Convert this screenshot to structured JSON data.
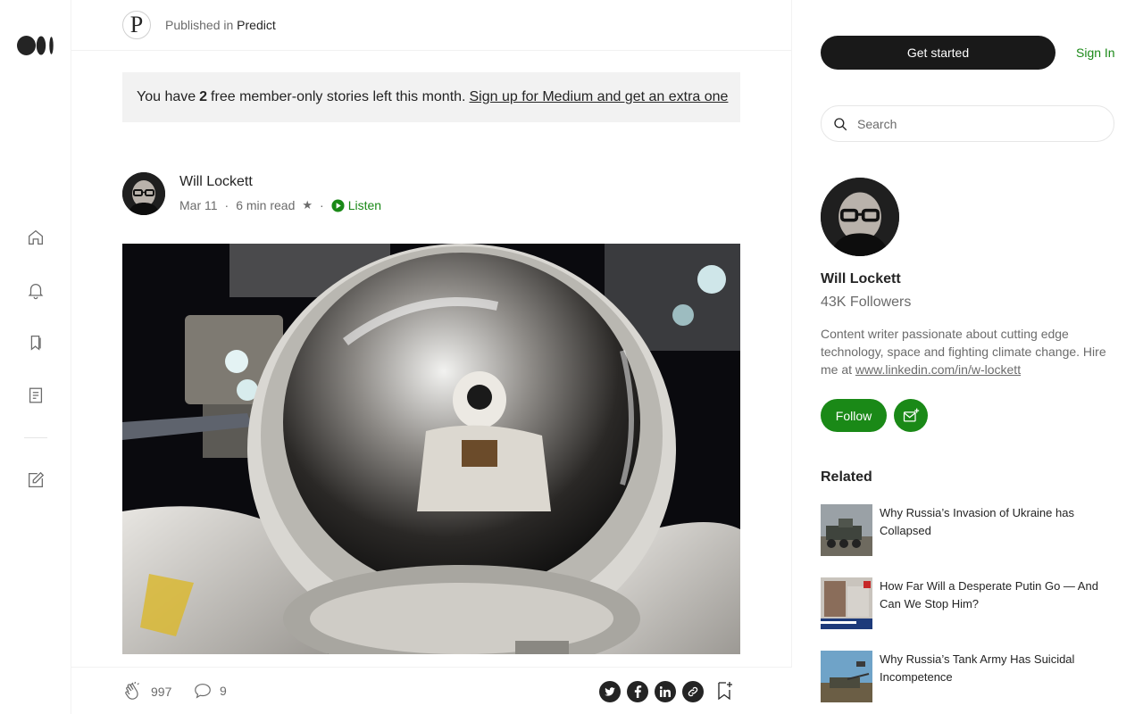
{
  "nav": {
    "brand": "Medium",
    "items": [
      "home-icon",
      "notifications-icon",
      "lists-icon",
      "stories-icon",
      "write-icon"
    ]
  },
  "publication": {
    "prefix": "Published in",
    "name": "Predict",
    "logo_letter": "P"
  },
  "banner": {
    "text_before": "You have",
    "count": "2",
    "text_after": "free member-only stories left this month.",
    "link": "Sign up for Medium and get an extra one"
  },
  "article": {
    "author": "Will Lockett",
    "date": "Mar 11",
    "read_time": "6 min read",
    "star": "★",
    "listen_label": "Listen"
  },
  "actions": {
    "claps": "997",
    "responses": "9",
    "share_icons": [
      "twitter-icon",
      "facebook-icon",
      "linkedin-icon",
      "link-icon"
    ]
  },
  "sidebar": {
    "get_started_label": "Get started",
    "sign_in_label": "Sign In",
    "search_placeholder": "Search",
    "author_name": "Will Lockett",
    "followers": "43K Followers",
    "bio": "Content writer passionate about cutting edge technology, space and fighting climate change. Hire me at",
    "bio_link": "www.linkedin.com/in/w-lockett",
    "follow_label": "Follow",
    "related_title": "Related",
    "related": [
      {
        "title": "Why Russia’s Invasion of Ukraine has Collapsed"
      },
      {
        "title": "How Far Will a Desperate Putin Go — And Can We Stop Him?"
      },
      {
        "title": "Why Russia’s Tank Army Has Suicidal Incompetence"
      }
    ]
  },
  "colors": {
    "accent_green": "#1a8917",
    "text_primary": "#242424",
    "text_secondary": "#6b6b6b",
    "banner_bg": "#f2f2f2",
    "button_dark": "#191919"
  }
}
